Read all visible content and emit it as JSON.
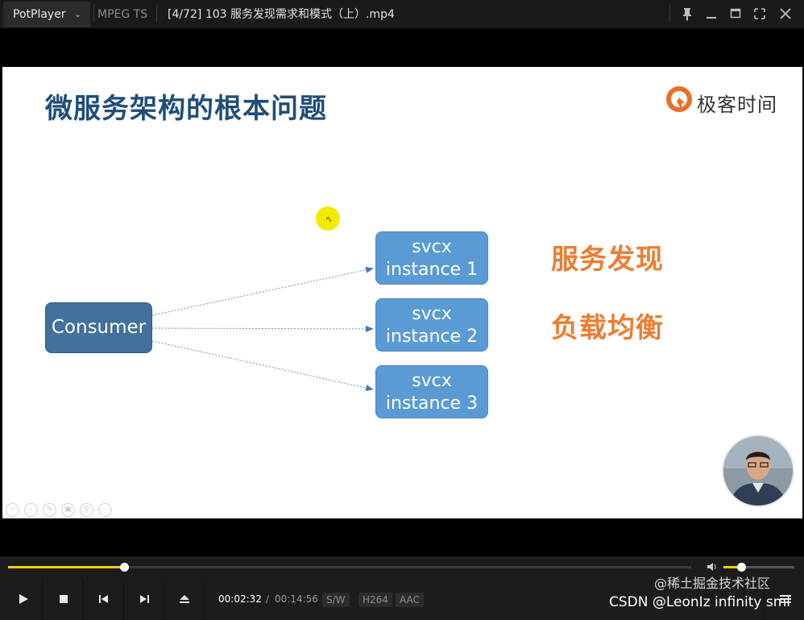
{
  "titlebar": {
    "app_name": "PotPlayer",
    "format": "MPEG TS",
    "file_title": "[4/72] 103 服务发现需求和模式（上）.mp4"
  },
  "slide": {
    "title": "微服务架构的根本问题",
    "logo_text": "极客时间",
    "consumer_label": "Consumer",
    "instances": [
      {
        "line1": "svcx",
        "line2": "instance 1"
      },
      {
        "line1": "svcx",
        "line2": "instance 2"
      },
      {
        "line1": "svcx",
        "line2": "instance 3"
      }
    ],
    "side_labels": [
      "服务发现",
      "负载均衡"
    ],
    "colors": {
      "title": "#1f4e79",
      "side": "#ed7d31",
      "instance": "#5b9bd5",
      "consumer": "#41719c"
    }
  },
  "playback": {
    "current_time": "00:02:32",
    "separator": "/",
    "total_time": "00:14:56",
    "progress_fraction": 0.17,
    "volume_fraction": 0.25,
    "tags": [
      "S/W",
      "H264",
      "AAC"
    ]
  },
  "watermarks": {
    "juejin": "@稀土掘金技术社区",
    "csdn": "CSDN @LeonIz infinity sml"
  },
  "icons": [
    "chevron-down-icon",
    "pin-icon",
    "minimize-icon",
    "maximize-icon",
    "fullscreen-icon",
    "close-icon",
    "play-icon",
    "stop-icon",
    "previous-icon",
    "next-icon",
    "eject-icon",
    "volume-icon",
    "menu-icon"
  ],
  "accent": "#f0d000"
}
